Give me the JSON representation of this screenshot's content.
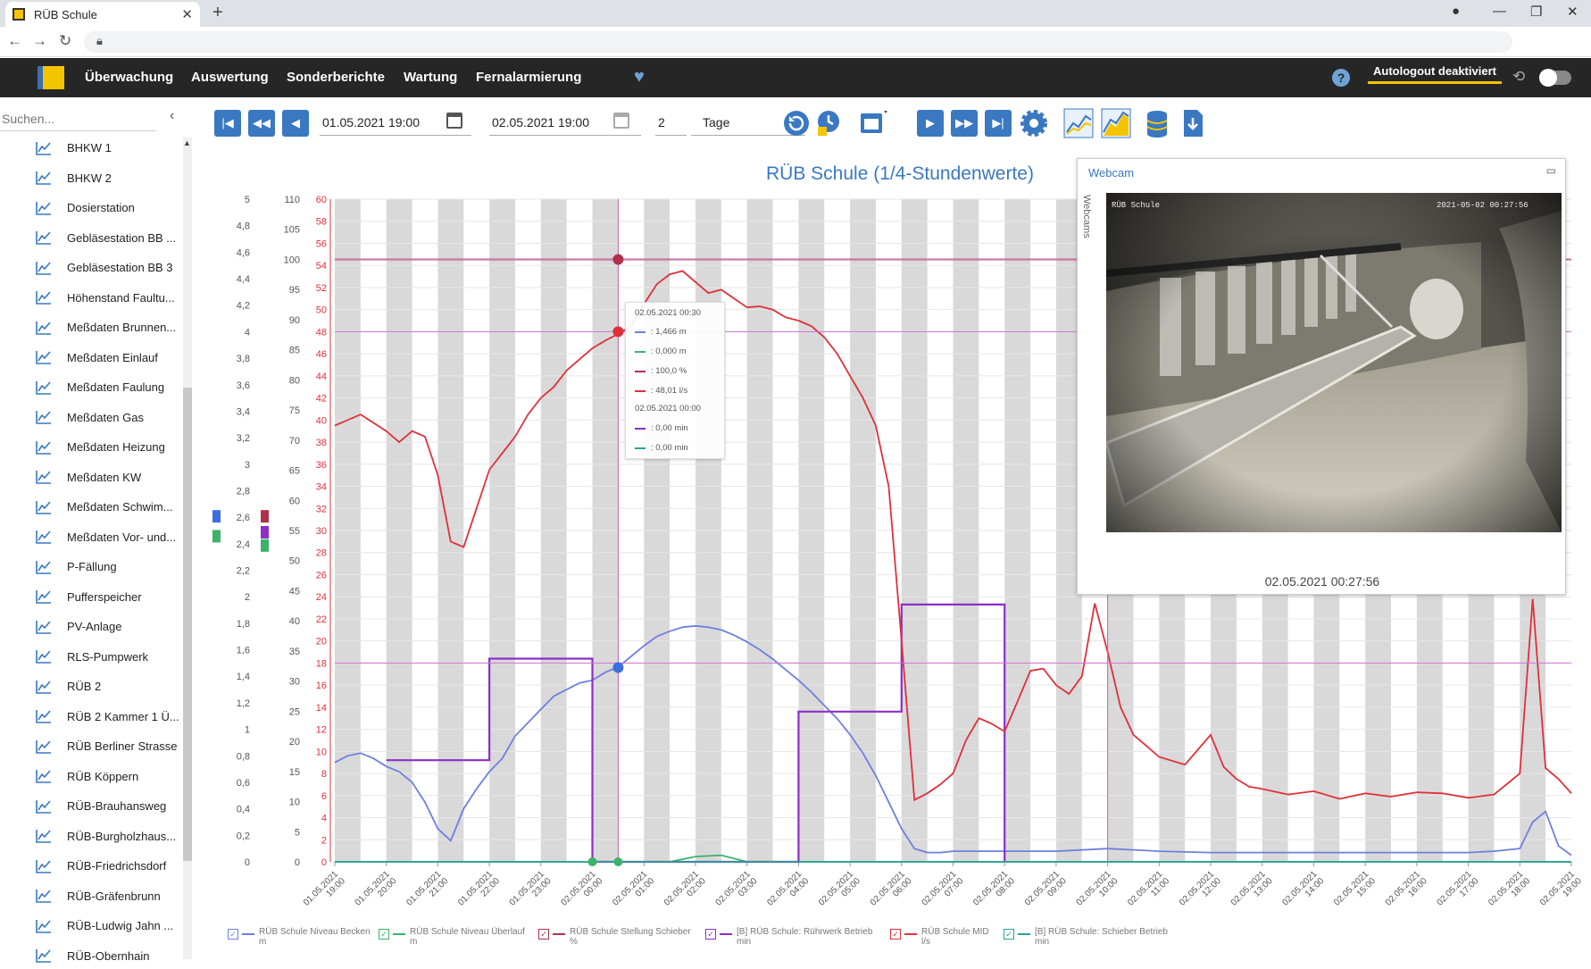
{
  "browser": {
    "tab_title": "RÜB Schule",
    "new_tab": "+",
    "close": "✕"
  },
  "app": {
    "menu": [
      "Überwachung",
      "Auswertung",
      "Sonderberichte",
      "Wartung",
      "Fernalarmierung"
    ],
    "autologout": "Autologout deaktiviert",
    "help": "?"
  },
  "sidebar": {
    "search_placeholder": "Suchen...",
    "items": [
      "BHKW 1",
      "BHKW 2",
      "Dosierstation",
      "Gebläsestation BB ...",
      "Gebläsestation BB 3",
      "Höhenstand Faultu...",
      "Meßdaten Brunnen...",
      "Meßdaten Einlauf",
      "Meßdaten Faulung",
      "Meßdaten Gas",
      "Meßdaten Heizung",
      "Meßdaten KW",
      "Meßdaten Schwim...",
      "Meßdaten Vor- und...",
      "P-Fällung",
      "Pufferspeicher",
      "PV-Anlage",
      "RLS-Pumpwerk",
      "RÜB 2",
      "RÜB 2 Kammer 1 Ü...",
      "RÜB Berliner Strasse",
      "RÜB Köppern",
      "RÜB-Brauhansweg",
      "RÜB-Burgholzhaus...",
      "RÜB-Friedrichsdorf",
      "RÜB-Gräfenbrunn",
      "RÜB-Ludwig Jahn ...",
      "RÜB-Obernhain"
    ]
  },
  "toolbar": {
    "date_from": "01.05.2021 19:00",
    "date_to": "02.05.2021 19:00",
    "count": "2",
    "unit": "Tage"
  },
  "webcam": {
    "title": "Webcam",
    "side_label": "Webcams",
    "timestamp": "02.05.2021 00:27:56",
    "overlay_left": "RÜB Schule",
    "overlay_right": "2021-05-02 00:27:56"
  },
  "tooltip": {
    "time1": "02.05.2021 00:30",
    "rows1": [
      ": 1,466 m",
      ": 0,000 m",
      ": 100,0 %",
      ": 48,01 l/s"
    ],
    "time2": "02.05.2021 00:00",
    "rows2": [
      ": 0,00 min",
      ": 0,00 min"
    ]
  },
  "colors": {
    "blue": "#6f7fe0",
    "green": "#3db26b",
    "darkred": "#b0304a",
    "purple": "#8b2fc9",
    "red": "#e0303a",
    "teal": "#2aa198",
    "accent": "#3a78c2",
    "brand": "#f5c400"
  },
  "chart_data": {
    "type": "line",
    "title": "RÜB Schule (1/4-Stundenwerte)",
    "x_ticks": [
      "01.05.2021 19:00",
      "01.05.2021 20:00",
      "01.05.2021 21:00",
      "01.05.2021 22:00",
      "01.05.2021 23:00",
      "02.05.2021 00:00",
      "02.05.2021 01:00",
      "02.05.2021 02:00",
      "02.05.2021 03:00",
      "02.05.2021 04:00",
      "02.05.2021 05:00",
      "02.05.2021 06:00",
      "02.05.2021 07:00",
      "02.05.2021 08:00",
      "02.05.2021 09:00",
      "02.05.2021 10:00",
      "02.05.2021 11:00",
      "02.05.2021 12:00",
      "02.05.2021 13:00",
      "02.05.2021 14:00",
      "02.05.2021 15:00",
      "02.05.2021 16:00",
      "02.05.2021 17:00",
      "02.05.2021 18:00",
      "02.05.2021 19:00"
    ],
    "axes": [
      {
        "name": "m",
        "min": 0,
        "max": 5,
        "ticks": [
          "0",
          "0,2",
          "0,4",
          "0,6",
          "0,8",
          "1",
          "1,2",
          "1,4",
          "1,6",
          "1,8",
          "2",
          "2,2",
          "2,4",
          "2,6",
          "2,8",
          "3",
          "3,2",
          "3,4",
          "3,6",
          "3,8",
          "4",
          "4,2",
          "4,4",
          "4,6",
          "4,8",
          "5"
        ]
      },
      {
        "name": "%",
        "min": 0,
        "max": 110,
        "ticks": [
          "0",
          "5",
          "10",
          "15",
          "20",
          "25",
          "30",
          "35",
          "40",
          "45",
          "50",
          "55",
          "60",
          "65",
          "70",
          "75",
          "80",
          "85",
          "90",
          "95",
          "100",
          "105",
          "110"
        ]
      },
      {
        "name": "l/s",
        "min": 0,
        "max": 60,
        "ticks": [
          "0",
          "2",
          "4",
          "6",
          "8",
          "10",
          "12",
          "14",
          "16",
          "18",
          "20",
          "22",
          "24",
          "26",
          "28",
          "30",
          "32",
          "34",
          "36",
          "38",
          "40",
          "42",
          "44",
          "46",
          "48",
          "50",
          "52",
          "54",
          "56",
          "58",
          "60"
        ]
      }
    ],
    "series": [
      {
        "name": "RÜB Schule Niveau Becken",
        "unit": "m",
        "color": "#6f7fe0",
        "axis": 0,
        "x": [
          0,
          0.25,
          0.5,
          0.75,
          1,
          1.25,
          1.5,
          1.75,
          2,
          2.25,
          2.5,
          2.75,
          3,
          3.25,
          3.5,
          3.75,
          4,
          4.25,
          4.5,
          4.75,
          5,
          5.25,
          5.5,
          5.75,
          6,
          6.25,
          6.5,
          6.75,
          7,
          7.25,
          7.5,
          7.75,
          8,
          8.25,
          8.5,
          8.75,
          9,
          9.25,
          9.5,
          9.75,
          10,
          10.25,
          10.5,
          10.75,
          11,
          11.25,
          11.5,
          11.75,
          12,
          12.5,
          13,
          14,
          15,
          15.5,
          16,
          17,
          18,
          19,
          20,
          21,
          22,
          22.5,
          23,
          23.25,
          23.5,
          23.75,
          24
        ],
        "y": [
          0.75,
          0.8,
          0.82,
          0.78,
          0.72,
          0.68,
          0.6,
          0.45,
          0.25,
          0.16,
          0.4,
          0.55,
          0.68,
          0.78,
          0.95,
          1.05,
          1.15,
          1.25,
          1.3,
          1.35,
          1.37,
          1.43,
          1.47,
          1.55,
          1.63,
          1.7,
          1.74,
          1.77,
          1.78,
          1.77,
          1.75,
          1.71,
          1.66,
          1.6,
          1.53,
          1.45,
          1.37,
          1.28,
          1.18,
          1.08,
          0.96,
          0.82,
          0.65,
          0.45,
          0.25,
          0.1,
          0.07,
          0.07,
          0.08,
          0.08,
          0.08,
          0.08,
          0.1,
          0.09,
          0.08,
          0.07,
          0.07,
          0.07,
          0.07,
          0.07,
          0.07,
          0.08,
          0.1,
          0.3,
          0.38,
          0.12,
          0.05
        ]
      },
      {
        "name": "RÜB Schule Niveau Überlauf",
        "unit": "m",
        "color": "#3db26b",
        "axis": 0,
        "x": [
          0,
          6.5,
          7,
          7.5,
          8,
          24
        ],
        "y": [
          0,
          0,
          0.04,
          0.05,
          0,
          0
        ]
      },
      {
        "name": "RÜB Schule Stellung Schieber",
        "unit": "%",
        "color": "#b0304a",
        "axis": 1,
        "x": [
          0,
          24
        ],
        "y": [
          100,
          100
        ]
      },
      {
        "name": "[B] RÜB Schule: Rührwerk Betrieb",
        "unit": "min",
        "color": "#8b2fc9",
        "axis": 2,
        "x": [
          1,
          3,
          3,
          5,
          5,
          9,
          9,
          11,
          11,
          13,
          13
        ],
        "y": [
          9.2,
          9.2,
          18.4,
          18.4,
          0,
          0,
          13.6,
          13.6,
          23.3,
          23.3,
          0
        ]
      },
      {
        "name": "RÜB Schule MID",
        "unit": "l/s",
        "color": "#e0303a",
        "axis": 2,
        "x": [
          0,
          0.5,
          1,
          1.25,
          1.5,
          1.75,
          2,
          2.25,
          2.5,
          2.75,
          3,
          3.25,
          3.5,
          3.75,
          4,
          4.25,
          4.5,
          4.75,
          5,
          5.25,
          5.5,
          5.75,
          6,
          6.25,
          6.5,
          6.75,
          7,
          7.25,
          7.5,
          7.75,
          8,
          8.25,
          8.5,
          8.75,
          9,
          9.25,
          9.5,
          9.75,
          10,
          10.25,
          10.5,
          10.75,
          11,
          11.25,
          11.5,
          11.75,
          12,
          12.25,
          12.5,
          12.75,
          13,
          13.25,
          13.5,
          13.75,
          14,
          14.25,
          14.5,
          14.75,
          15,
          15.25,
          15.5,
          15.75,
          16,
          16.5,
          17,
          17.25,
          17.5,
          17.75,
          18,
          18.5,
          19,
          19.5,
          20,
          20.5,
          21,
          21.5,
          22,
          22.5,
          23,
          23.25,
          23.5,
          23.75,
          24
        ],
        "y": [
          39.5,
          40.5,
          39,
          38,
          39,
          38.5,
          35,
          29,
          28.5,
          32,
          35.5,
          37,
          38.5,
          40.5,
          42,
          43,
          44.5,
          45.5,
          46.5,
          47.2,
          47.8,
          48.5,
          50.5,
          52.3,
          53.2,
          53.5,
          52.5,
          51.5,
          51.8,
          51,
          50.2,
          50.3,
          50,
          49.3,
          49,
          48.5,
          47.5,
          46,
          44,
          42,
          39.5,
          34,
          20,
          5.6,
          6.2,
          7,
          8,
          11,
          13,
          12.5,
          11.8,
          14.5,
          17.3,
          17.5,
          16,
          15.2,
          16.8,
          23.4,
          19,
          14,
          11.5,
          10.5,
          9.5,
          8.8,
          11.5,
          8.6,
          7.5,
          6.8,
          6.6,
          6.1,
          6.4,
          5.7,
          6.2,
          5.9,
          6.3,
          6.2,
          5.8,
          6.1,
          8,
          23.8,
          8.5,
          7.5,
          6.2
        ]
      },
      {
        "name": "[B] RÜB Schule: Schieber Betrieb",
        "unit": "min",
        "color": "#2aa198",
        "axis": 2,
        "x": [
          0,
          24
        ],
        "y": [
          0,
          0
        ]
      }
    ],
    "grid": true,
    "legend": "bottom"
  }
}
